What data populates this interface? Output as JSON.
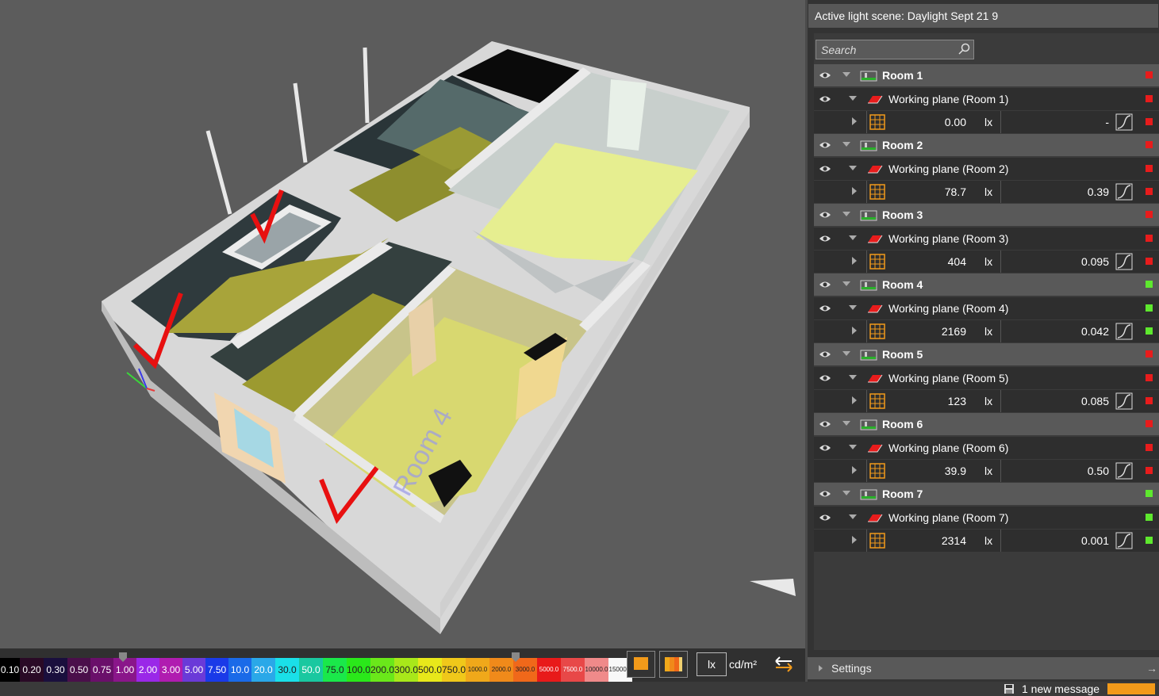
{
  "panel": {
    "active_scene_label": "Active light scene: Daylight Sept 21 9",
    "search_placeholder": "Search",
    "settings_label": "Settings"
  },
  "rooms": [
    {
      "name": "Room 1",
      "plane": "Working plane (Room 1)",
      "value": "0.00",
      "unit": "lx",
      "ratio": "-",
      "status": "#e81c1c"
    },
    {
      "name": "Room 2",
      "plane": "Working plane (Room 2)",
      "value": "78.7",
      "unit": "lx",
      "ratio": "0.39",
      "status": "#e81c1c"
    },
    {
      "name": "Room 3",
      "plane": "Working plane (Room 3)",
      "value": "404",
      "unit": "lx",
      "ratio": "0.095",
      "status": "#e81c1c"
    },
    {
      "name": "Room 4",
      "plane": "Working plane (Room 4)",
      "value": "2169",
      "unit": "lx",
      "ratio": "0.042",
      "status": "#5ee82e"
    },
    {
      "name": "Room 5",
      "plane": "Working plane (Room 5)",
      "value": "123",
      "unit": "lx",
      "ratio": "0.085",
      "status": "#e81c1c"
    },
    {
      "name": "Room 6",
      "plane": "Working plane (Room 6)",
      "value": "39.9",
      "unit": "lx",
      "ratio": "0.50",
      "status": "#e81c1c"
    },
    {
      "name": "Room 7",
      "plane": "Working plane (Room 7)",
      "value": "2314",
      "unit": "lx",
      "ratio": "0.001",
      "status": "#5ee82e"
    }
  ],
  "legend": [
    {
      "label": "0.10",
      "color": "#000000"
    },
    {
      "label": "0.20",
      "color": "#2a0a26"
    },
    {
      "label": "0.30",
      "color": "#1a0f3d"
    },
    {
      "label": "0.50",
      "color": "#4a0f4a"
    },
    {
      "label": "0.75",
      "color": "#6a0f6a"
    },
    {
      "label": "1.00",
      "color": "#8a168a"
    },
    {
      "label": "2.00",
      "color": "#9a28e8"
    },
    {
      "label": "3.00",
      "color": "#b01cb0"
    },
    {
      "label": "5.00",
      "color": "#6a3ad8"
    },
    {
      "label": "7.50",
      "color": "#1a3ae8"
    },
    {
      "label": "10.0",
      "color": "#1a6ae8"
    },
    {
      "label": "20.0",
      "color": "#2aa8e8"
    },
    {
      "label": "30.0",
      "color": "#1ae0e8"
    },
    {
      "label": "50.0",
      "color": "#1ac8a0"
    },
    {
      "label": "75.0",
      "color": "#1ae84a"
    },
    {
      "label": "100.0",
      "color": "#2ae81a"
    },
    {
      "label": "200.0",
      "color": "#6ae81a"
    },
    {
      "label": "300.0",
      "color": "#a8e81a"
    },
    {
      "label": "500.0",
      "color": "#e8e81a"
    },
    {
      "label": "750.0",
      "color": "#f0c81a"
    },
    {
      "label": "1000.0",
      "color": "#f0a81a"
    },
    {
      "label": "2000.0",
      "color": "#f08a1a"
    },
    {
      "label": "3000.0",
      "color": "#f0681a"
    },
    {
      "label": "5000.0",
      "color": "#e81a1a"
    },
    {
      "label": "7500.0",
      "color": "#e84848"
    },
    {
      "label": "10000.0",
      "color": "#f08a8a"
    },
    {
      "label": "15000.0",
      "color": "#f8f8f8"
    }
  ],
  "units": {
    "lx": "lx",
    "cd": "cd/m²"
  },
  "scene_label": "Room 4",
  "status_bar": {
    "message": "1 new message"
  }
}
